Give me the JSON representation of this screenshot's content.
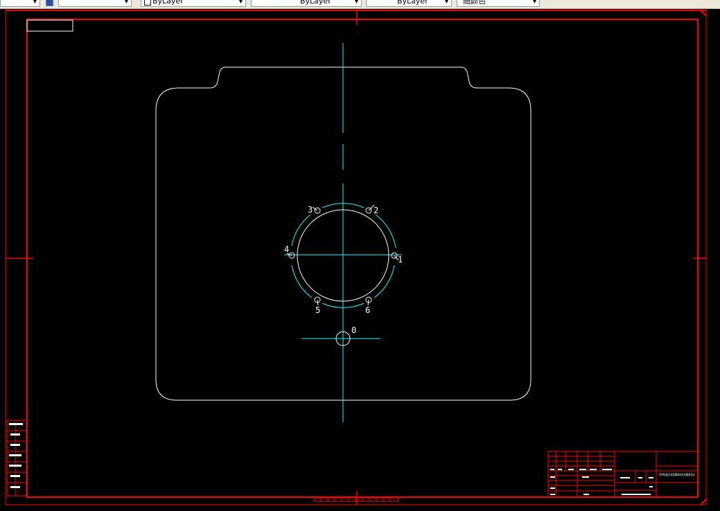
{
  "toolbar": {
    "dimstyle_value": "",
    "color_value": "ByLayer",
    "linetype_value": "ByLayer",
    "lineweight_value": "ByLayer",
    "plotstyle_value": "随颜色"
  },
  "drawing": {
    "hole_labels": [
      "1",
      "2",
      "3",
      "4",
      "5",
      "6"
    ],
    "center_label": "0",
    "colors": {
      "frame": "#ff0000",
      "outline": "#ffffff",
      "centerline": "#00ffff",
      "background": "#000000"
    }
  },
  "title_block": {
    "drawing_title": "ZAP轧辊主成型模具钻孔钻模具设计"
  }
}
